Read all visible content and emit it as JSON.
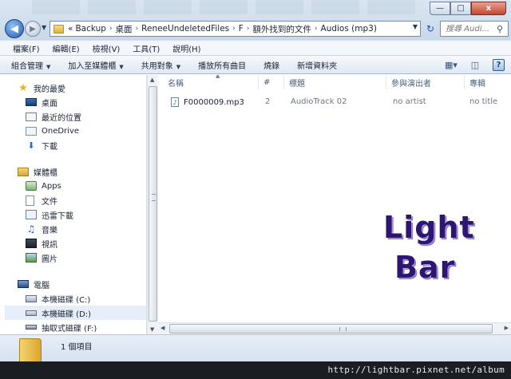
{
  "address": {
    "crumbs": [
      "Backup",
      "桌面",
      "ReneeUndeletedFiles",
      "F",
      "額外找到的文件",
      "Audios (mp3)"
    ],
    "overflow_mark": "«",
    "sep": "›"
  },
  "search": {
    "placeholder": "搜尋 Audi..."
  },
  "window_buttons": {
    "minimize": "—",
    "maximize": "□",
    "close": "x"
  },
  "menu": [
    "檔案(F)",
    "編輯(E)",
    "檢視(V)",
    "工具(T)",
    "說明(H)"
  ],
  "commands": [
    {
      "label": "組合管理",
      "dropdown": true
    },
    {
      "label": "加入至媒體櫃",
      "dropdown": true
    },
    {
      "label": "共用對象",
      "dropdown": true
    },
    {
      "label": "播放所有曲目",
      "dropdown": false
    },
    {
      "label": "燒錄",
      "dropdown": false
    },
    {
      "label": "新增資料夾",
      "dropdown": false
    }
  ],
  "nav": {
    "favorites_header": "我的最愛",
    "favorites": [
      "桌面",
      "最近的位置",
      "OneDrive",
      "下載"
    ],
    "libraries_header": "媒體櫃",
    "libraries": [
      "Apps",
      "文件",
      "迅雷下載",
      "音樂",
      "視訊",
      "圖片"
    ],
    "computer_header": "電腦",
    "drives": [
      "本機磁碟 (C:)",
      "本機磁碟 (D:)",
      "抽取式磁碟 (F:)"
    ]
  },
  "columns": [
    "名稱",
    "#",
    "標題",
    "參與演出者",
    "專輯"
  ],
  "files": [
    {
      "name": "F0000009.mp3",
      "track": "2",
      "title": "AudioTrack 02",
      "artist": "no artist",
      "album": "no title"
    }
  ],
  "watermark": {
    "line1": "Light",
    "line2": "Bar"
  },
  "status": {
    "count_text": "1 個項目"
  },
  "footer_url": "http://lightbar.pixnet.net/album",
  "icons": {
    "back": "back-arrow-icon",
    "forward": "forward-arrow-icon",
    "refresh": "refresh-icon",
    "search": "search-icon",
    "help": "help-icon",
    "view": "view-options-icon",
    "preview": "preview-pane-icon"
  }
}
